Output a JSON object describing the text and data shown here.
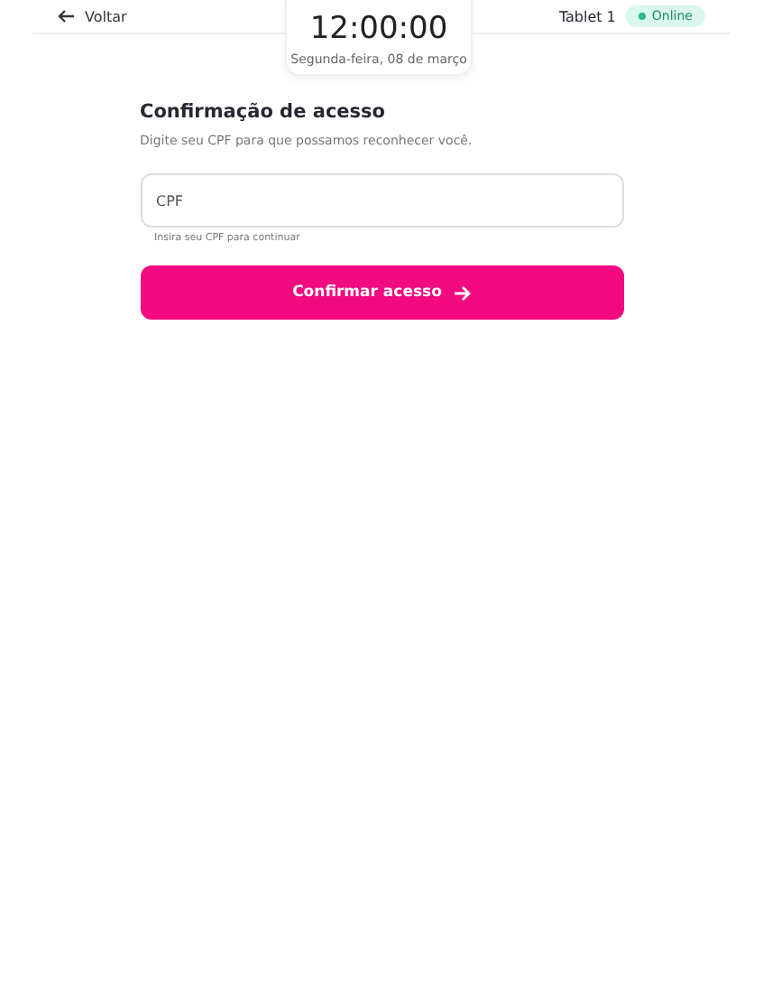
{
  "header": {
    "back_label": "Voltar",
    "device": "Tablet 1",
    "status": "Online"
  },
  "clock": {
    "time": "12:00:00",
    "date": "Segunda-feira, 08 de março"
  },
  "form": {
    "title": "Confirmação de acesso",
    "subtitle": "Digite seu CPF para que possamos reconhecer você.",
    "field": {
      "placeholder": "CPF",
      "helper": "Insira seu CPF para continuar"
    },
    "submit": "Confirmar acesso"
  }
}
